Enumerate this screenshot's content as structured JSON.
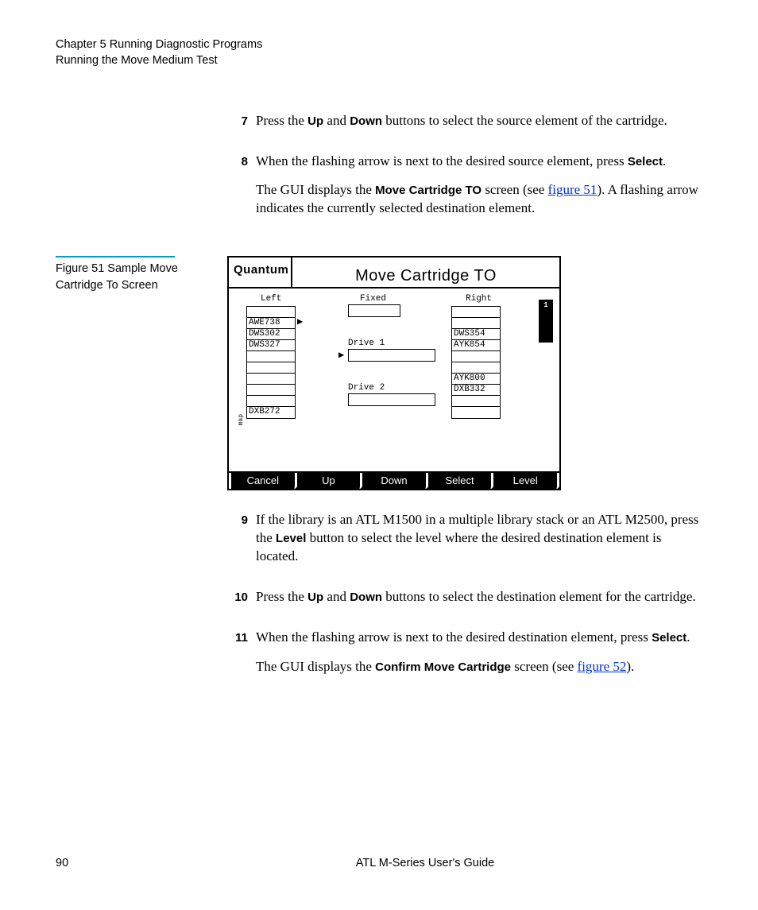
{
  "header": {
    "line1": "Chapter 5  Running Diagnostic Programs",
    "line2": "Running the Move Medium Test"
  },
  "steps": {
    "s7": {
      "num": "7",
      "text_a": "Press the ",
      "up": "Up",
      "text_b": " and ",
      "down": "Down",
      "text_c": " buttons to select the source element of the cartridge."
    },
    "s8": {
      "num": "8",
      "text_a": "When the flashing arrow is next to the desired source element, press ",
      "select": "Select",
      "text_b": ".",
      "para2_a": "The GUI displays the ",
      "para2_bold": "Move Cartridge TO",
      "para2_b": " screen (see ",
      "para2_link": "figure 51",
      "para2_c": "). A flashing arrow indicates the currently selected destination element."
    },
    "s9": {
      "num": "9",
      "text_a": "If the library is an ATL M1500 in a multiple library stack or an ATL M2500, press the ",
      "level": "Level",
      "text_b": " button to select the level where the desired destination element is located."
    },
    "s10": {
      "num": "10",
      "text_a": "Press the ",
      "up": "Up",
      "text_b": " and ",
      "down": "Down",
      "text_c": " buttons to select the destination element for the cartridge."
    },
    "s11": {
      "num": "11",
      "text_a": "When the flashing arrow is next to the desired destination element, press ",
      "select": "Select",
      "text_b": ".",
      "para2_a": "The GUI displays the ",
      "para2_bold": "Confirm Move Cartridge",
      "para2_b": " screen (see ",
      "para2_link": "figure 52",
      "para2_c": ")."
    }
  },
  "figure": {
    "caption": "Figure 51  Sample Move Cartridge To Screen",
    "brand": "Quantum",
    "title": "Move Cartridge  TO",
    "left_head": "Left",
    "fixed_head": "Fixed",
    "right_head": "Right",
    "drive1": "Drive 1",
    "drive2": "Drive 2",
    "map": "map",
    "left_slots": [
      "",
      "AWE738",
      "DWS302",
      "DWS327",
      "",
      "",
      "",
      "",
      "",
      "DXB272"
    ],
    "right_slots": [
      "",
      "",
      "DWS354",
      "AYK854",
      "",
      "",
      "AYK800",
      "DXB332",
      "",
      ""
    ],
    "buttons": [
      "Cancel",
      "Up",
      "Down",
      "Select",
      "Level"
    ]
  },
  "footer": {
    "page": "90",
    "title": "ATL M-Series User's Guide"
  }
}
